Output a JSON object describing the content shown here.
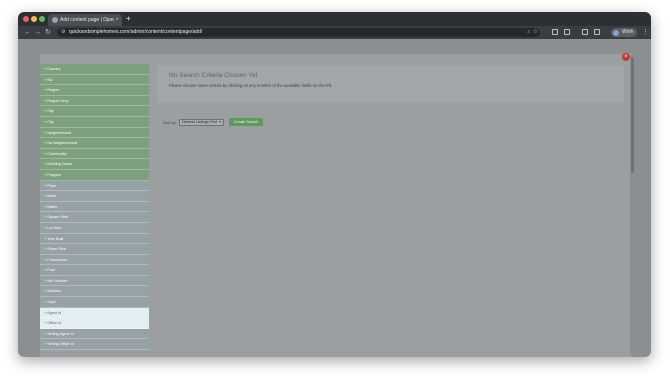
{
  "browser": {
    "tab_title": "Add content page | Django s",
    "tab_close": "×",
    "new_tab": "+",
    "url": "quickandsimplehomes.com/admin/content/contentpage/add/",
    "profile_label": "Work",
    "nav": {
      "back": "←",
      "forward": "→",
      "reload": "↻"
    }
  },
  "modal": {
    "close_symbol": "×"
  },
  "filters": {
    "items": [
      {
        "label": "+ Country",
        "style": "green"
      },
      {
        "label": "+ Biz",
        "style": "green"
      },
      {
        "label": "+ Region",
        "style": "green"
      },
      {
        "label": "+ Region Grey",
        "style": "green"
      },
      {
        "label": "+ City",
        "style": "green"
      },
      {
        "label": "+ City",
        "style": "green"
      },
      {
        "label": "+ Neighborhood",
        "style": "green"
      },
      {
        "label": "+ No Neighborhood",
        "style": "green"
      },
      {
        "label": "+ Community",
        "style": "green"
      },
      {
        "label": "+ Building Name",
        "style": "green"
      },
      {
        "label": "+ Polygon",
        "style": "green"
      },
      {
        "label": "+ Price",
        "style": "gray"
      },
      {
        "label": "+ Beds",
        "style": "gray"
      },
      {
        "label": "+ Baths",
        "style": "gray"
      },
      {
        "label": "+ Square Feet",
        "style": "gray"
      },
      {
        "label": "+ Lot Size",
        "style": "gray"
      },
      {
        "label": "+ Year Built",
        "style": "gray"
      },
      {
        "label": "+ Street Size",
        "style": "gray"
      },
      {
        "label": "+ Foreclosure",
        "style": "gray"
      },
      {
        "label": "+ Pool",
        "style": "gray"
      },
      {
        "label": "+ Mls Number",
        "style": "gray"
      },
      {
        "label": "+ Address",
        "style": "gray"
      },
      {
        "label": "+ Style",
        "style": "gray"
      },
      {
        "label": "+ Agent Id",
        "style": "highlight"
      },
      {
        "label": "+ Office Id",
        "style": "highlight"
      },
      {
        "label": "+ Selling Agent Id",
        "style": "gray"
      },
      {
        "label": "+ Selling Office Id",
        "style": "gray"
      }
    ]
  },
  "panel": {
    "title": "No Search Criteria Chosen Yet",
    "text": "Please choose some criteria by clicking on any number of the available fields on the left."
  },
  "sort": {
    "label": "Sort by:",
    "selected": "Newest Listings First",
    "create_button": "Create Search"
  }
}
